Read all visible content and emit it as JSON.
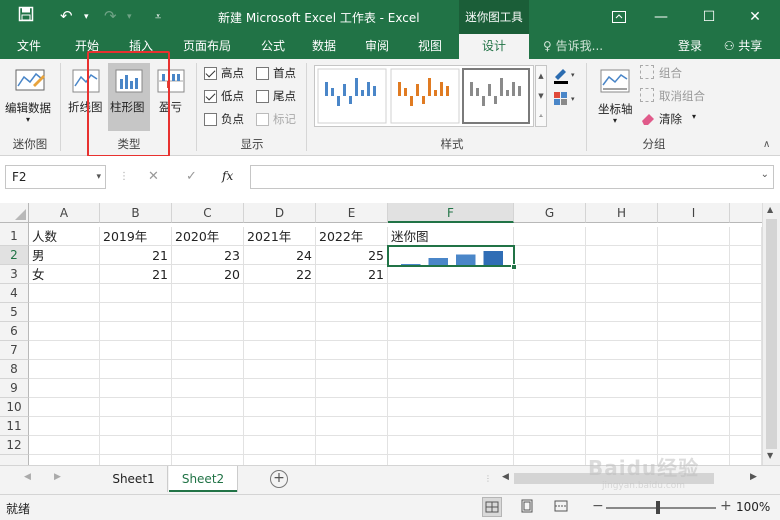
{
  "titlebar": {
    "document_title": "新建 Microsoft Excel 工作表 - Excel",
    "context_tool_title": "迷你图工具"
  },
  "tabs": [
    "文件",
    "开始",
    "插入",
    "页面布局",
    "公式",
    "数据",
    "审阅",
    "视图",
    "设计"
  ],
  "tell_me": "告诉我...",
  "login": "登录",
  "share": "共享",
  "ribbon": {
    "sparkline_group": {
      "edit_data": "编辑数据",
      "label": "迷你图"
    },
    "type_group": {
      "line": "折线图",
      "column": "柱形图",
      "winloss": "盈亏",
      "label": "类型"
    },
    "show_group": {
      "label": "显示",
      "high": "高点",
      "low": "低点",
      "negative": "负点",
      "first": "首点",
      "last": "尾点",
      "markers": "标记"
    },
    "style_group": {
      "label": "样式"
    },
    "group_group": {
      "axis": "坐标轴",
      "group": "组合",
      "ungroup": "取消组合",
      "clear": "清除",
      "label": "分组"
    }
  },
  "formula_bar": {
    "name_box": "F2",
    "fx": "fx",
    "value": ""
  },
  "columns": [
    "A",
    "B",
    "C",
    "D",
    "E",
    "F",
    "G",
    "H",
    "I"
  ],
  "rows": [
    "1",
    "2",
    "3",
    "4",
    "5",
    "6",
    "7",
    "8",
    "9",
    "10",
    "11",
    "12"
  ],
  "cells": {
    "r1": [
      "人数",
      "2019年",
      "2020年",
      "2021年",
      "2022年",
      "迷你图"
    ],
    "r2": [
      "男",
      "21",
      "23",
      "24",
      "25"
    ],
    "r3": [
      "女",
      "21",
      "20",
      "22",
      "21"
    ]
  },
  "sparkline_values": [
    21,
    23,
    24,
    25
  ],
  "sheets": [
    "Sheet1",
    "Sheet2"
  ],
  "status": {
    "ready": "就绪",
    "zoom": "100%"
  },
  "watermark": "Baidu经验 jingyan.baidu.com",
  "colors": {
    "accent": "#217346",
    "highlight_box": "#e8312f",
    "sparkline": "#4a86c8"
  }
}
